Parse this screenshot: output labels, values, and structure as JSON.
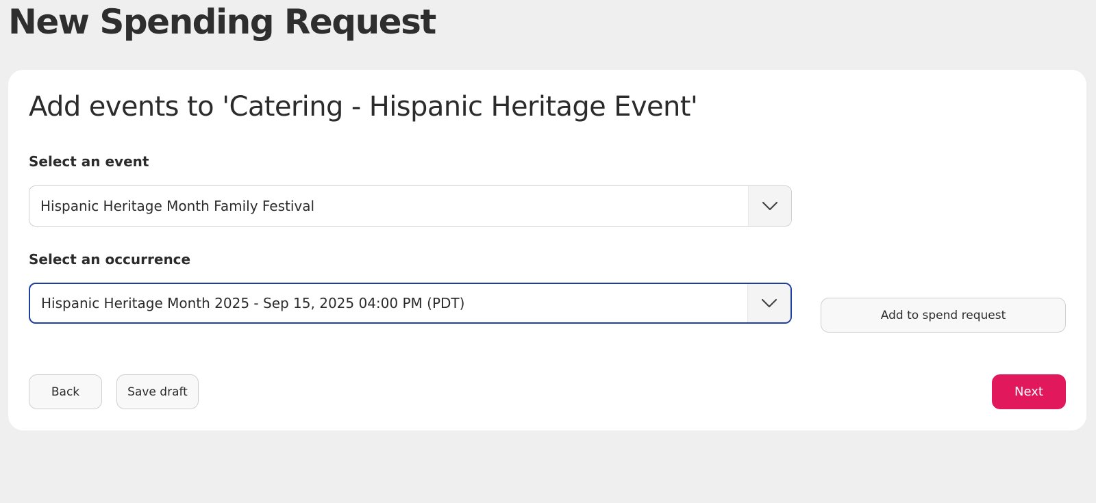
{
  "page": {
    "title": "New Spending Request"
  },
  "form": {
    "title": "Add events to 'Catering - Hispanic Heritage Event'",
    "event_select": {
      "label": "Select an event",
      "value": "Hispanic Heritage Month Family Festival",
      "icon": "chevron-down-icon"
    },
    "occurrence_select": {
      "label": "Select an occurrence",
      "value": "Hispanic Heritage Month 2025 - Sep 15, 2025 04:00 PM (PDT)",
      "icon": "chevron-down-icon",
      "focused": true
    },
    "add_button_label": "Add to spend request"
  },
  "footer": {
    "back_label": "Back",
    "save_draft_label": "Save draft",
    "next_label": "Next"
  },
  "colors": {
    "page_background": "#efefef",
    "card_background": "#ffffff",
    "accent": "#e2185c",
    "focus_border": "#1f3fa0",
    "text": "#2b2b2b"
  }
}
